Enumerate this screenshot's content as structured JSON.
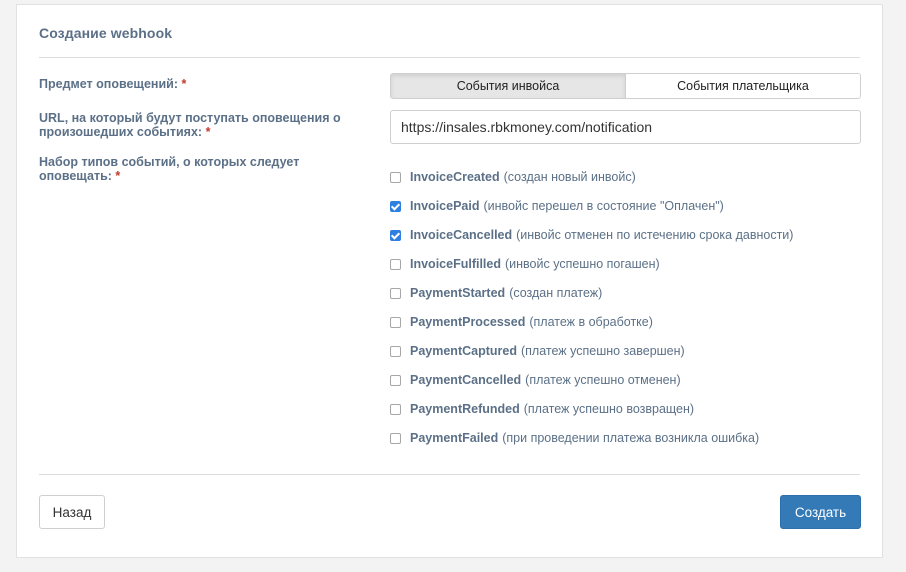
{
  "panel": {
    "title": "Создание webhook"
  },
  "form": {
    "subject": {
      "label": "Предмет оповещений:",
      "required_mark": "*"
    },
    "url": {
      "label": "URL, на который будут поступать оповещения о произошедших событиях:",
      "required_mark": "*",
      "value": "https://insales.rbkmoney.com/notification"
    },
    "events": {
      "label": "Набор типов событий, о которых следует оповещать:",
      "required_mark": "*"
    }
  },
  "toggle": {
    "options": [
      {
        "label": "События инвойса",
        "active": true
      },
      {
        "label": "События плательщика",
        "active": false
      }
    ]
  },
  "event_list": [
    {
      "name": "InvoiceCreated",
      "desc": "(создан новый инвойс)",
      "checked": false
    },
    {
      "name": "InvoicePaid",
      "desc": "(инвойс перешел в состояние \"Оплачен\")",
      "checked": true
    },
    {
      "name": "InvoiceCancelled",
      "desc": "(инвойс отменен по истечению срока давности)",
      "checked": true
    },
    {
      "name": "InvoiceFulfilled",
      "desc": "(инвойс успешно погашен)",
      "checked": false
    },
    {
      "name": "PaymentStarted",
      "desc": "(создан платеж)",
      "checked": false
    },
    {
      "name": "PaymentProcessed",
      "desc": "(платеж в обработке)",
      "checked": false
    },
    {
      "name": "PaymentCaptured",
      "desc": "(платеж успешно завершен)",
      "checked": false
    },
    {
      "name": "PaymentCancelled",
      "desc": "(платеж успешно отменен)",
      "checked": false
    },
    {
      "name": "PaymentRefunded",
      "desc": "(платеж успешно возвращен)",
      "checked": false
    },
    {
      "name": "PaymentFailed",
      "desc": "(при проведении платежа возникла ошибка)",
      "checked": false
    }
  ],
  "buttons": {
    "back": "Назад",
    "create": "Создать"
  },
  "colors": {
    "accent": "#337ab7",
    "label": "#5b7087",
    "required": "#c0392b",
    "checkbox": "#2f7fe0"
  }
}
